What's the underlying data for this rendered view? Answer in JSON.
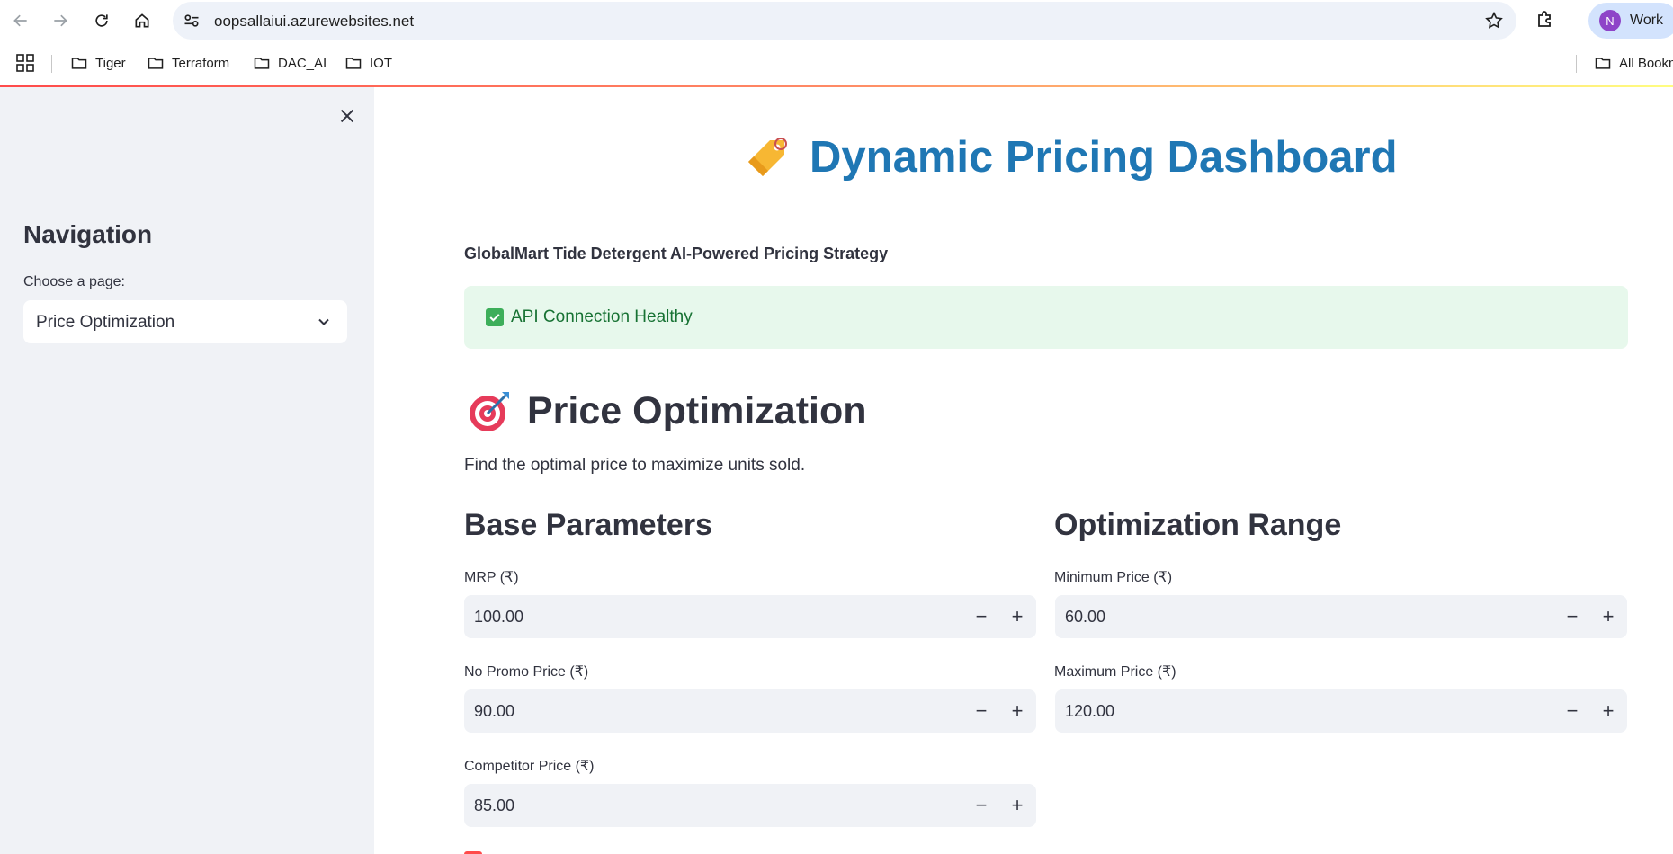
{
  "browser": {
    "url": "oopsallaiui.azurewebsites.net",
    "profile_initial": "N",
    "profile_label": "Work",
    "bookmarks": [
      "Tiger",
      "Terraform",
      "DAC_AI",
      "IOT"
    ],
    "all_bookmarks_label": "All Bookmarks"
  },
  "sidebar": {
    "title": "Navigation",
    "choose_label": "Choose a page:",
    "selected_page": "Price Optimization"
  },
  "main": {
    "title": "Dynamic Pricing Dashboard",
    "subtitle": "GlobalMart Tide Detergent AI-Powered Pricing Strategy",
    "status_message": "API Connection Healthy",
    "section_title": "Price Optimization",
    "section_desc": "Find the optimal price to maximize units sold.",
    "base_params": {
      "title": "Base Parameters",
      "mrp_label": "MRP (₹)",
      "mrp_value": "100.00",
      "no_promo_label": "No Promo Price (₹)",
      "no_promo_value": "90.00",
      "competitor_label": "Competitor Price (₹)",
      "competitor_value": "85.00"
    },
    "opt_range": {
      "title": "Optimization Range",
      "min_label": "Minimum Price (₹)",
      "min_value": "60.00",
      "max_label": "Maximum Price (₹)",
      "max_value": "120.00"
    },
    "minus": "−",
    "plus": "+"
  },
  "colors": {
    "accent": "#ff4b4b",
    "title_blue": "#1f77b4",
    "success_bg": "#e7f8ec",
    "success_text": "#177233"
  }
}
